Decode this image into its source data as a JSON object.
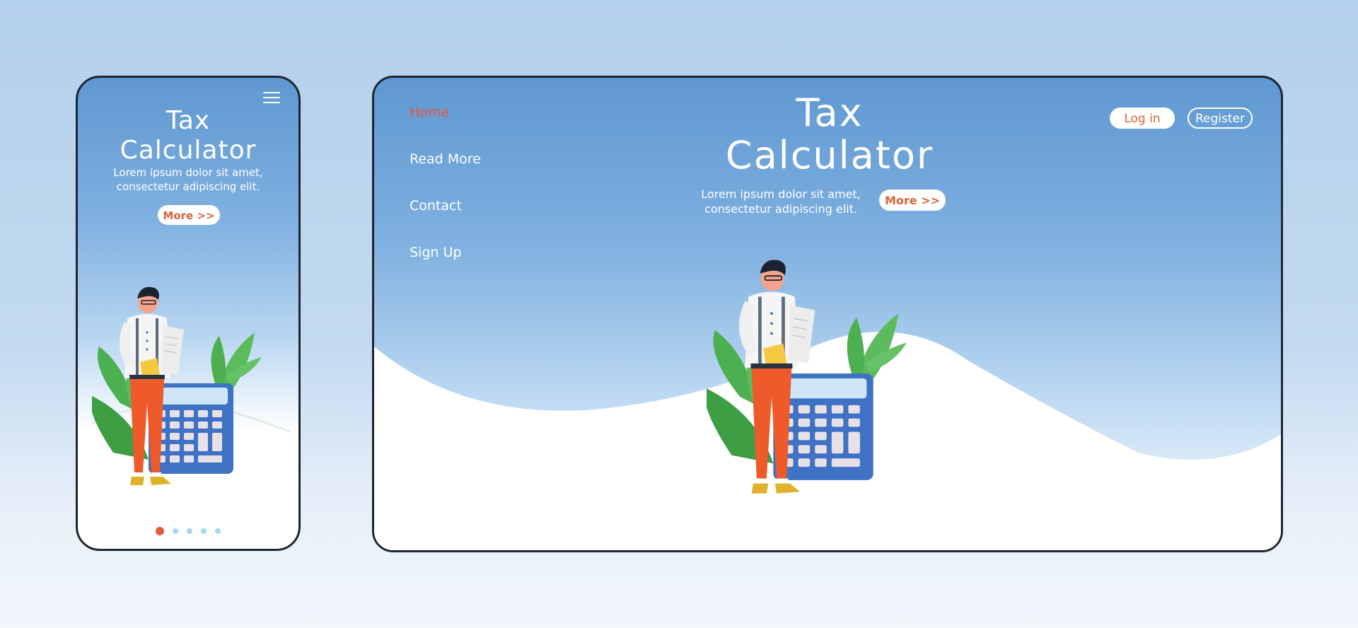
{
  "mobile": {
    "title_line1": "Tax",
    "title_line2": "Calculator",
    "subtitle_line1": "Lorem ipsum dolor sit amet,",
    "subtitle_line2": "consectetur adipiscing elit.",
    "more_label": "More >>",
    "menu_icon": "hamburger-menu-icon",
    "pagination": {
      "count": 5,
      "active": 1
    }
  },
  "desktop": {
    "nav": [
      {
        "label": "Home",
        "active": true
      },
      {
        "label": "Read More",
        "active": false
      },
      {
        "label": "Contact",
        "active": false
      },
      {
        "label": "Sign Up",
        "active": false
      }
    ],
    "title_line1": "Tax",
    "title_line2": "Calculator",
    "subtitle_line1": "Lorem ipsum dolor sit amet,",
    "subtitle_line2": "consectetur adipiscing elit.",
    "more_label": "More >>",
    "login_label": "Log in",
    "register_label": "Register"
  },
  "colors": {
    "background": "#b3d0ec",
    "header_gradient_top": "#5f98d2",
    "accent": "#e35a3a",
    "button_text": "#d8643a",
    "frame_border": "#1f2630",
    "calculator": "#3f72c4",
    "leaves": "#4caf50",
    "trousers": "#ee5a2a"
  }
}
